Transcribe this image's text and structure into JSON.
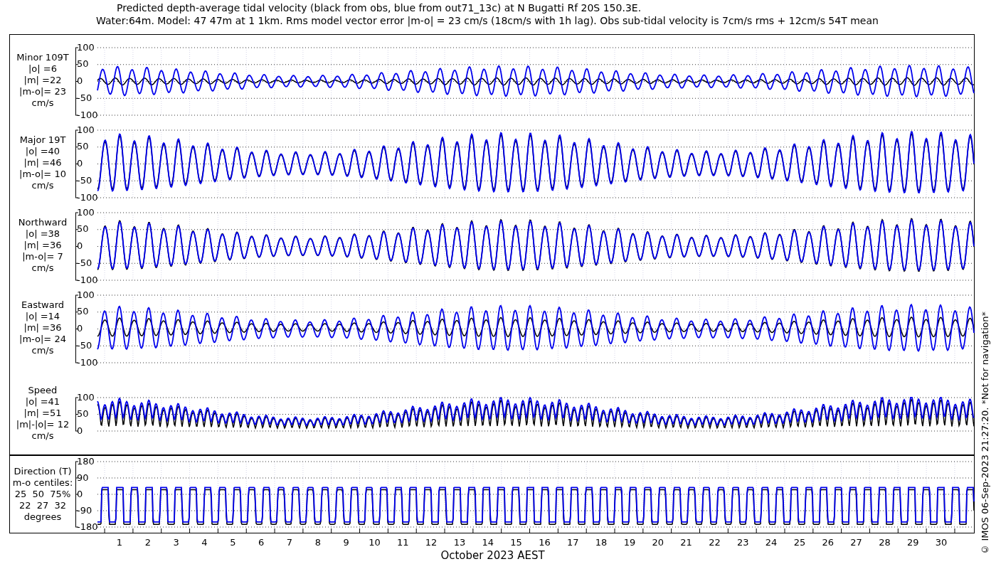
{
  "title_lines": [
    "Predicted depth-average tidal velocity (black from obs, blue from out71_13c) at N Bugatti Rf 20S 150.3E.",
    "Water:64m. Model: 47 47m at 1 1km. Rms model vector error |m-o| = 23 cm/s (18cm/s with 1h lag). Obs sub-tidal velocity is 7cm/s rms + 12cm/s 54T mean"
  ],
  "panels": [
    {
      "kind": "minor",
      "label_lines": [
        "Minor 109T",
        "|o| =6",
        "|m| =22",
        "|m-o|= 23",
        "cm/s"
      ],
      "y_ticks": [
        "100",
        "50",
        "0",
        "-50",
        "-100"
      ]
    },
    {
      "kind": "major",
      "label_lines": [
        "Major 19T",
        "|o| =40",
        "|m| =46",
        "|m-o|= 10",
        "cm/s"
      ],
      "y_ticks": [
        "100",
        "50",
        "0",
        "-50",
        "-100"
      ]
    },
    {
      "kind": "northward",
      "label_lines": [
        "Northward",
        "|o| =38",
        "|m| =36",
        "|m-o|= 7",
        "cm/s"
      ],
      "y_ticks": [
        "100",
        "50",
        "0",
        "-50",
        "-100"
      ]
    },
    {
      "kind": "eastward",
      "label_lines": [
        "Eastward",
        "|o| =14",
        "|m| =36",
        "|m-o|= 24",
        "cm/s"
      ],
      "y_ticks": [
        "100",
        "50",
        "0",
        "-50",
        "-100"
      ]
    },
    {
      "kind": "speed",
      "label_lines": [
        "Speed",
        "|o| =41",
        "|m| =51",
        "|m|-|o|= 12",
        "cm/s"
      ],
      "y_ticks": [
        "100",
        "50",
        "0"
      ]
    },
    {
      "kind": "direction",
      "label_lines": [
        "Direction (T)",
        "m-o centiles:",
        "25  50  75%",
        "22  27  32",
        "degrees"
      ],
      "y_ticks": [
        "180",
        "90",
        "0",
        "-90",
        "-180"
      ]
    }
  ],
  "x_axis": {
    "day_labels": [
      "1",
      "2",
      "3",
      "4",
      "5",
      "6",
      "7",
      "8",
      "9",
      "10",
      "11",
      "12",
      "13",
      "14",
      "15",
      "16",
      "17",
      "18",
      "19",
      "20",
      "21",
      "22",
      "23",
      "24",
      "25",
      "26",
      "27",
      "28",
      "29",
      "30"
    ],
    "label": "October 2023 AEST"
  },
  "footer_note": "© IMOS 06-Sep-2023 21:27:20. *Not for navigation*"
}
